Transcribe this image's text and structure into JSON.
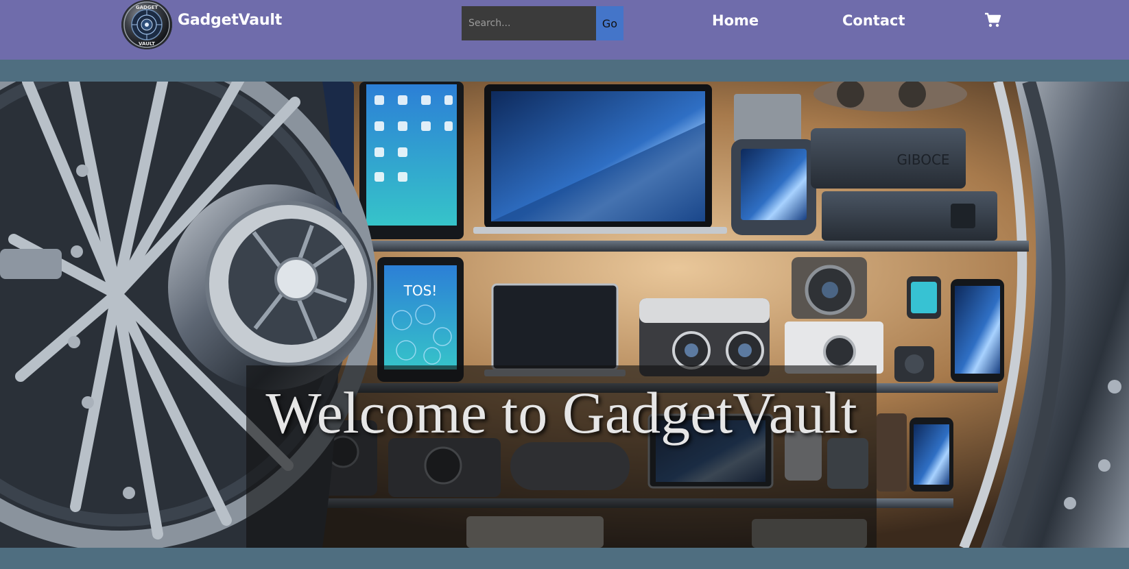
{
  "header": {
    "brand_name": "GadgetVault",
    "logo_text": "GADGET VAULT",
    "search": {
      "placeholder": "Search...",
      "button_label": "Go"
    },
    "nav": {
      "home_label": "Home",
      "contact_label": "Contact"
    },
    "cart_icon": "shopping-cart-icon"
  },
  "hero": {
    "title": "Welcome to GadgetVault",
    "background": "vault door with shelves of gadgets"
  },
  "colors": {
    "header_bg": "#6f6cab",
    "page_bg": "#4f6e80",
    "go_button": "#4475c9",
    "search_bg": "#3b3b3b"
  }
}
